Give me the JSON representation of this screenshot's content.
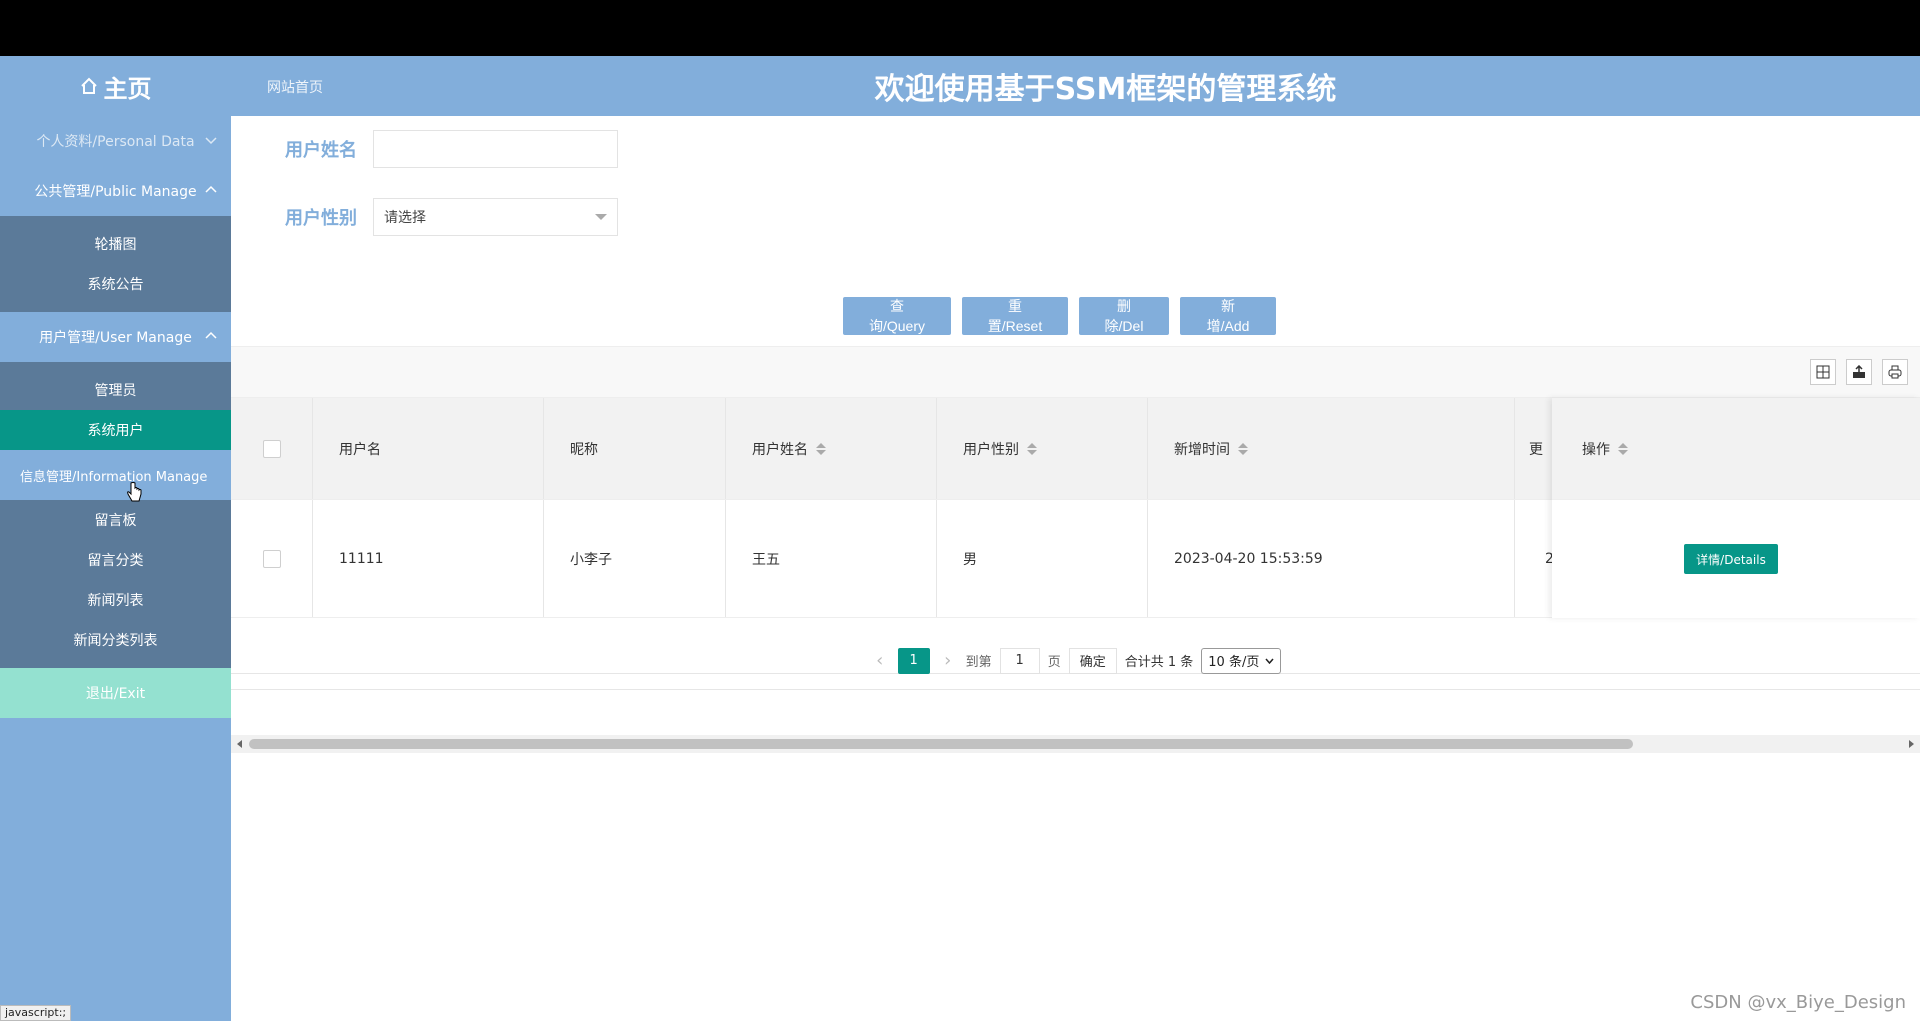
{
  "header": {
    "home_label": "主页",
    "breadcrumb": "网站首页",
    "title": "欢迎使用基于SSM框架的管理系统"
  },
  "sidebar": {
    "groups": [
      {
        "label": "个人资料/Personal Data",
        "expanded": false,
        "items": []
      },
      {
        "label": "公共管理/Public Manage",
        "expanded": true,
        "items": [
          "轮播图",
          "系统公告"
        ]
      },
      {
        "label": "用户管理/User Manage",
        "expanded": true,
        "items": [
          "管理员",
          "系统用户"
        ]
      },
      {
        "label": "信息管理/Information Manage",
        "expanded": true,
        "items": [
          "留言板",
          "留言分类",
          "新闻列表",
          "新闻分类列表"
        ]
      }
    ],
    "active_item": "系统用户",
    "exit_label": "退出/Exit"
  },
  "search": {
    "name_label": "用户姓名",
    "name_value": "",
    "gender_label": "用户性别",
    "gender_placeholder": "请选择"
  },
  "actions": {
    "query": "查询/Query",
    "reset": "重置/Reset",
    "delete": "删除/Del",
    "add": "新增/Add"
  },
  "table": {
    "columns": [
      "用户名",
      "昵称",
      "用户姓名",
      "用户性别",
      "新增时间",
      "更",
      "操作"
    ],
    "rows": [
      {
        "username": "11111",
        "nickname": "小李子",
        "realname": "王五",
        "gender": "男",
        "created": "2023-04-20 15:53:59",
        "updated": "2",
        "action": "详情/Details"
      }
    ]
  },
  "pagination": {
    "current": "1",
    "goto_label": "到第",
    "goto_value": "1",
    "page_unit": "页",
    "confirm": "确定",
    "total": "合计共 1 条",
    "page_size": "10 条/页"
  },
  "status_tip": "javascript:;",
  "watermark": "CSDN @vx_Biye_Design",
  "colors": {
    "primary": "#82aedb",
    "active": "#079688",
    "exit": "#94e1d0",
    "submenu": "#5b7a99"
  }
}
